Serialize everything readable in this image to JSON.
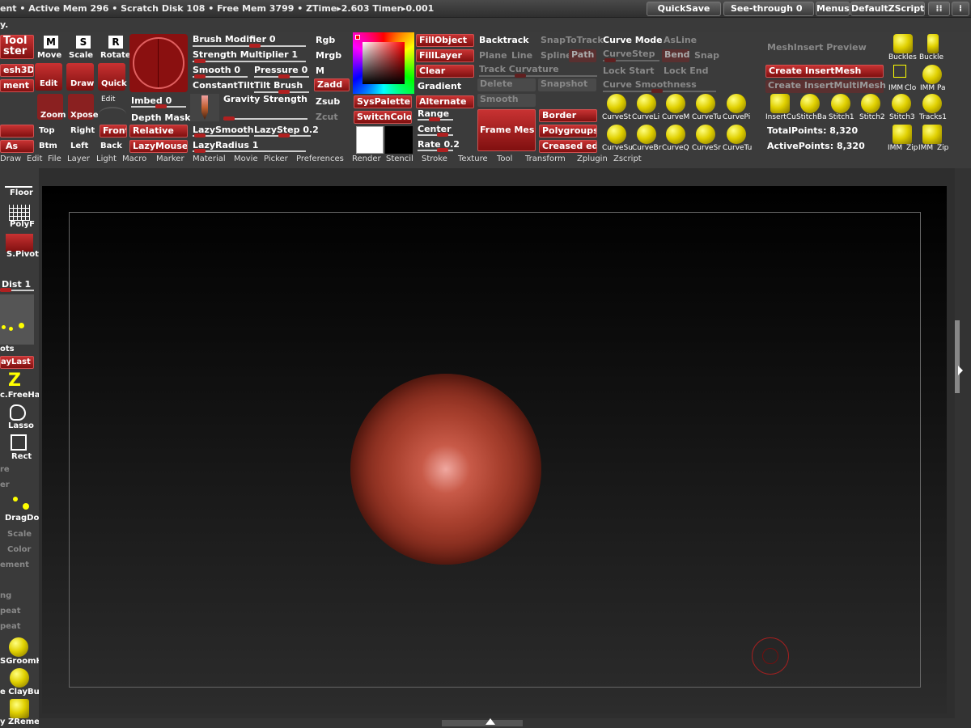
{
  "titlebar": {
    "status": "ent  • Active Mem 296 • Scratch Disk 108 • Free Mem 3799 • ZTime▸2.603  Timer▸0.001",
    "quicksave": "QuickSave",
    "seethrough": "See-through  0",
    "menus": "Menus",
    "script": "DefaultZScript"
  },
  "second_line": "y.",
  "tool_group": {
    "tool": "Tool",
    "ster": "ster",
    "mesh3d": "esh3D",
    "ment": "ment",
    "move": "Move",
    "scale": "Scale",
    "rotate": "Rotate",
    "edit": "Edit",
    "draw": "Draw",
    "quick": "Quick",
    "zoom": "Zoom",
    "xpose": "Xpose",
    "edit_dim": "Edit"
  },
  "brush": {
    "modifier": "Brush Modifier 0",
    "strength_multiplier": "Strength Multiplier 1",
    "smooth": "Smooth 0",
    "pressure": "Pressure 0",
    "constanttilt": "ConstantTilt",
    "tilt_brush": "Tilt Brush",
    "imbed": "Imbed 0",
    "depth_mask": "Depth Mask",
    "gravity": "Gravity Strength",
    "lazysmooth": "LazySmooth",
    "lazystep": "LazyStep 0.2",
    "lazyradius": "LazyRadius 1",
    "front": "Front",
    "relative": "Relative",
    "lazymouse": "LazyMouse",
    "top": "Top",
    "right": "Right",
    "btm": "Btm",
    "left": "Left",
    "back": "Back"
  },
  "color": {
    "rgb": "Rgb",
    "mrgb": "Mrgb",
    "m": "M",
    "zadd": "Zadd",
    "zsub": "Zsub",
    "zcut": "Zcut",
    "fillobject": "FillObject",
    "filllayer": "FillLayer",
    "clear": "Clear",
    "gradient": "Gradient",
    "syspalette": "SysPalette",
    "alternate": "Alternate",
    "switchcolor": "SwitchColor",
    "range": "Range",
    "center": "Center",
    "rate": "Rate 0.2"
  },
  "stroke": {
    "backtrack": "Backtrack",
    "snaptotrack": "SnapToTrack",
    "plane": "Plane",
    "line": "Line",
    "spline": "Spline",
    "path": "Path",
    "track_curvature": "Track Curvature",
    "delete": "Delete",
    "snapshot": "Snapshot",
    "smooth": "Smooth",
    "frame_mesh": "Frame Mesh",
    "border": "Border",
    "polygroups": "Polygroups",
    "creased": "Creased edg"
  },
  "curve": {
    "mode": "Curve Mode",
    "asline": "AsLine",
    "curvestep": "CurveStep",
    "bend": "Bend",
    "snap": "Snap",
    "lockstart": "Lock Start",
    "lockend": "Lock End",
    "smoothness": "Curve Smoothness",
    "icons_row1": [
      "CurveSt",
      "CurveLi",
      "CurveM",
      "CurveTu",
      "CurvePi"
    ],
    "icons_row2": [
      "CurveSu",
      "CurveBr",
      "CurveQ",
      "CurveSr",
      "CurveTu"
    ]
  },
  "insert": {
    "preview": "MeshInsert Preview",
    "create": "Create InsertMesh",
    "create_multi": "Create InsertMultiMesh",
    "icons_row1": [
      "InsertCu",
      "StitchBa",
      "Stitch1",
      "Stitch2",
      "Stitch3",
      "Tracks1"
    ],
    "total_points": "TotalPoints: 8,320",
    "active_points": "ActivePoints: 8,320",
    "icons_top": [
      "Buckles",
      "Buckle"
    ],
    "icons_mid": [
      "IMM",
      "Clo",
      "IMM",
      "Pa"
    ],
    "icons_bot": [
      "IMM",
      "Zip",
      "IMM",
      "Zip"
    ]
  },
  "menubar": [
    "Draw",
    "Edit",
    "File",
    "Layer",
    "Light",
    "Macro",
    "Marker",
    "Material",
    "Movie",
    "Picker",
    "Preferences",
    "Render",
    "Stencil",
    "Stroke",
    "Texture",
    "Tool",
    "Transform",
    "Zplugin",
    "Zscript"
  ],
  "shelf": {
    "floor": "Floor",
    "polyf": "PolyF",
    "spivot": "S.Pivot",
    "dist": "Dist 1",
    "dots": "ots",
    "laylast": "ayLast",
    "freehand": "c.FreeHan",
    "lasso": "Lasso",
    "rect": "Rect",
    "re": "re",
    "er": "er",
    "dragdot": "DragDot",
    "scale": "Scale",
    "color": "Color",
    "ement": "ement",
    "ng": "ng",
    "peat1": "peat",
    "peat2": "peat",
    "groom": "SGroomH",
    "claybuild": "e ClayBuil",
    "zremesh": "y ZRemesl"
  },
  "colors": {
    "accent": "#b02020",
    "sphere": "#a8402e",
    "highlight": "#ffff00"
  }
}
